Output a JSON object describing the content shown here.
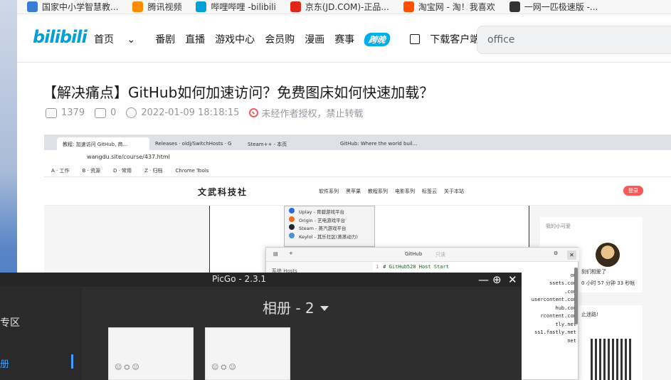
{
  "bookmarks": [
    {
      "label": "国家中小学智慧教...",
      "color": "#3a7bd5"
    },
    {
      "label": "腾讯视频",
      "color": "#ff8c00"
    },
    {
      "label": "哔哩哔哩 -bilibili",
      "color": "#00a1d6"
    },
    {
      "label": "京东(JD.COM)-正品...",
      "color": "#e1251b"
    },
    {
      "label": "淘宝网 - 淘！我喜欢",
      "color": "#ff5000"
    },
    {
      "label": "一网一匹极速版 -...",
      "color": "#333333"
    }
  ],
  "header": {
    "logo": "bilibili",
    "nav": [
      "首页",
      "番剧",
      "直播",
      "游戏中心",
      "会员购",
      "漫画",
      "赛事"
    ],
    "badge": "跨晚",
    "download": "下载客户端",
    "search_value": "office"
  },
  "article": {
    "title": "【解决痛点】GitHub如何加速访问？免费图床如何快速加载？",
    "views": "1379",
    "comments": "0",
    "datetime": "2022-01-09 18:18:15",
    "license": "未经作者授权，禁止转载"
  },
  "embedded": {
    "tabs": [
      "教程: 加速访问 GitHub, 商... ",
      "Releases · oldj/SwitchHosts · G",
      "Steam++ - 本页",
      "GitHub: Where the world buil..."
    ],
    "url": "wangdu.site/course/437.html",
    "bookmarks": [
      "A · 工作",
      "B · 资源",
      "D · 常用",
      "Z · 归档",
      "Chrome Tools"
    ],
    "site_name": "文武科技社",
    "site_menu": [
      "软件系列",
      "黑苹果",
      "教程系列",
      "电影系列",
      "标签云",
      "关于本站"
    ],
    "login": "登录",
    "platform_list": [
      {
        "label": "Uplay - 育碧游戏平台",
        "color": "#2b6cd4"
      },
      {
        "label": "Origin - 艺电游戏平台",
        "color": "#f26b1d"
      },
      {
        "label": "Steam - 蒸汽游戏平台",
        "color": "#1b2838"
      },
      {
        "label": "Keylol - 其乐社区(蒸蒸动力)",
        "color": "#4a8fd8"
      }
    ],
    "side_title": "我的小可爱",
    "side_text1": "刻们相爱了",
    "side_text2": "0 小时 57 分钟 33 秒帐",
    "side_title2": "止迷路!",
    "hosts_title": "GitHub",
    "hosts_tag": "只读",
    "hosts_left": "系统 Hosts",
    "hosts_lines": [
      {
        "n": "1",
        "t": "# GitHub520 Host Start"
      },
      {
        "n": "",
        "t": "om"
      },
      {
        "n": "",
        "t": "ssets.com"
      },
      {
        "n": "",
        "t": ".com"
      },
      {
        "n": "",
        "t": "usercontent.com"
      },
      {
        "n": "",
        "t": "hub.com"
      },
      {
        "n": "",
        "t": "rcontent.com"
      },
      {
        "n": "",
        "t": "tly.net"
      },
      {
        "n": "",
        "t": "ss1.fastly.net"
      },
      {
        "n": "",
        "t": "net"
      }
    ]
  },
  "picgo": {
    "title": "PicGo - 2.3.1",
    "minimize": "—",
    "maximize": "⊕",
    "close": "✕",
    "zone": "专区",
    "album_nav": "册",
    "heading": "相册 - 2"
  }
}
